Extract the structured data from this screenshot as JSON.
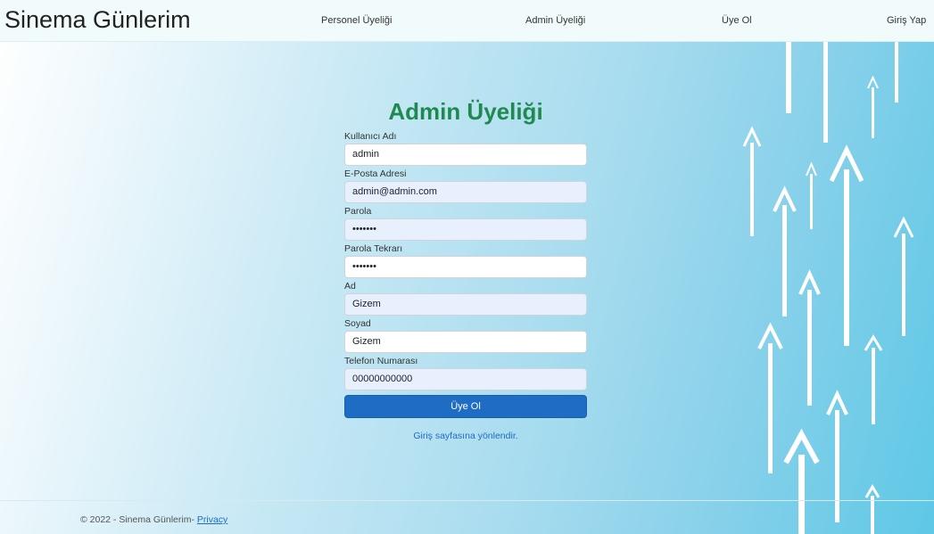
{
  "navbar": {
    "brand": "Sinema Günlerim",
    "links": [
      "Personel Üyeliği",
      "Admin Üyeliği",
      "Üye Ol",
      "Giriş Yap"
    ]
  },
  "form": {
    "title": "Admin Üyeliği",
    "fields": [
      {
        "label": "Kullanıcı Adı",
        "value": "admin"
      },
      {
        "label": "E-Posta Adresi",
        "value": "admin@admin.com"
      },
      {
        "label": "Parola",
        "value": "•••••••"
      },
      {
        "label": "Parola Tekrarı",
        "value": "•••••••"
      },
      {
        "label": "Ad",
        "value": "Gizem"
      },
      {
        "label": "Soyad",
        "value": "Gizem"
      },
      {
        "label": "Telefon Numarası",
        "value": "00000000000"
      }
    ],
    "submit_label": "Üye Ol",
    "redirect_link": "Giriş sayfasına yönlendir."
  },
  "footer": {
    "copyright": "© 2022 - Sinema Günlerim- ",
    "privacy_link": "Privacy"
  },
  "theme": {
    "title_color": "#1f8a50",
    "button_color": "#1e6cc4",
    "autofill_color": "#e8f0fe"
  },
  "decoration": {
    "background_icon": "rising-arrows-icon"
  }
}
